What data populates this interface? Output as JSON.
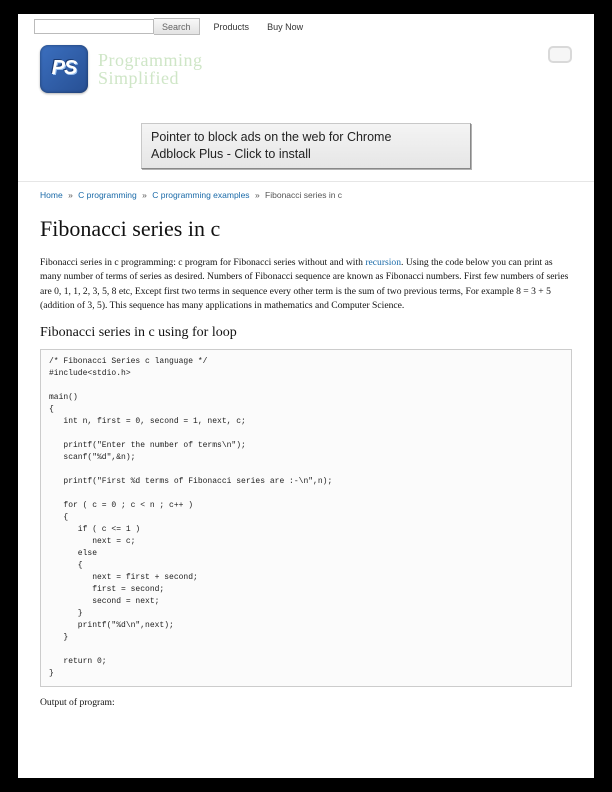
{
  "topbar": {
    "search_placeholder": "",
    "search_value": "",
    "search_button": "Search",
    "nav": [
      "Products",
      "Buy Now"
    ]
  },
  "logo": {
    "line1": "Programming",
    "line2": "Simplified"
  },
  "ad": {
    "line1": "Pointer to block ads on the web for Chrome",
    "line2": "Adblock Plus - Click to install"
  },
  "breadcrumbs": {
    "items": [
      "Home",
      "C programming",
      "C programming examples"
    ],
    "current": "Fibonacci series in c"
  },
  "article": {
    "title": "Fibonacci series in c",
    "intro_before_link": "Fibonacci series in c programming: c program for Fibonacci series without and with ",
    "intro_link": "recursion",
    "intro_after_link": ". Using the code below you can print as many number of terms of series as desired. Numbers of Fibonacci sequence are known as Fibonacci numbers. First few numbers of series are 0, 1, 1, 2, 3, 5, 8 etc, Except first two terms in sequence every other term is the sum of two previous terms, For example 8 = 3 + 5 (addition of 3, 5). This sequence has many applications in mathematics and Computer Science.",
    "section_title": "Fibonacci series in c using for loop",
    "code": "/* Fibonacci Series c language */\n#include<stdio.h>\n\nmain()\n{\n   int n, first = 0, second = 1, next, c;\n\n   printf(\"Enter the number of terms\\n\");\n   scanf(\"%d\",&n);\n\n   printf(\"First %d terms of Fibonacci series are :-\\n\",n);\n\n   for ( c = 0 ; c < n ; c++ )\n   {\n      if ( c <= 1 )\n         next = c;\n      else\n      {\n         next = first + second;\n         first = second;\n         second = next;\n      }\n      printf(\"%d\\n\",next);\n   }\n\n   return 0;\n}",
    "output_label": "Output of program:"
  }
}
